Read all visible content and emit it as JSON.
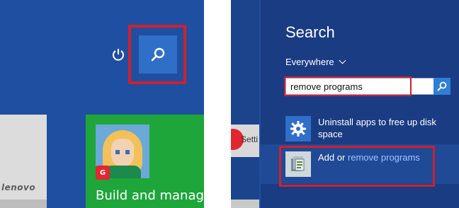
{
  "start_screen": {
    "power_icon": "power-icon",
    "search_icon": "search-icon",
    "tiles": {
      "brand_text": "lenovo",
      "game_badge": "G",
      "app_title": "Build and manage"
    }
  },
  "search_charm": {
    "title": "Search",
    "scope": "Everywhere",
    "query": "remove programs",
    "results": [
      {
        "label": "Uninstall apps to free up disk space",
        "icon": "gear-icon"
      },
      {
        "label_prefix": "Add or ",
        "label_highlight": "remove programs",
        "icon": "control-panel-icon"
      }
    ],
    "background_tile_label": "Setti"
  },
  "colors": {
    "start_bg": "#1f4fa0",
    "search_pane_bg": "#1a3c82",
    "highlight_border": "#d0202f",
    "accent_blue": "#2f7fd6",
    "tile_green": "#1ea63b"
  }
}
